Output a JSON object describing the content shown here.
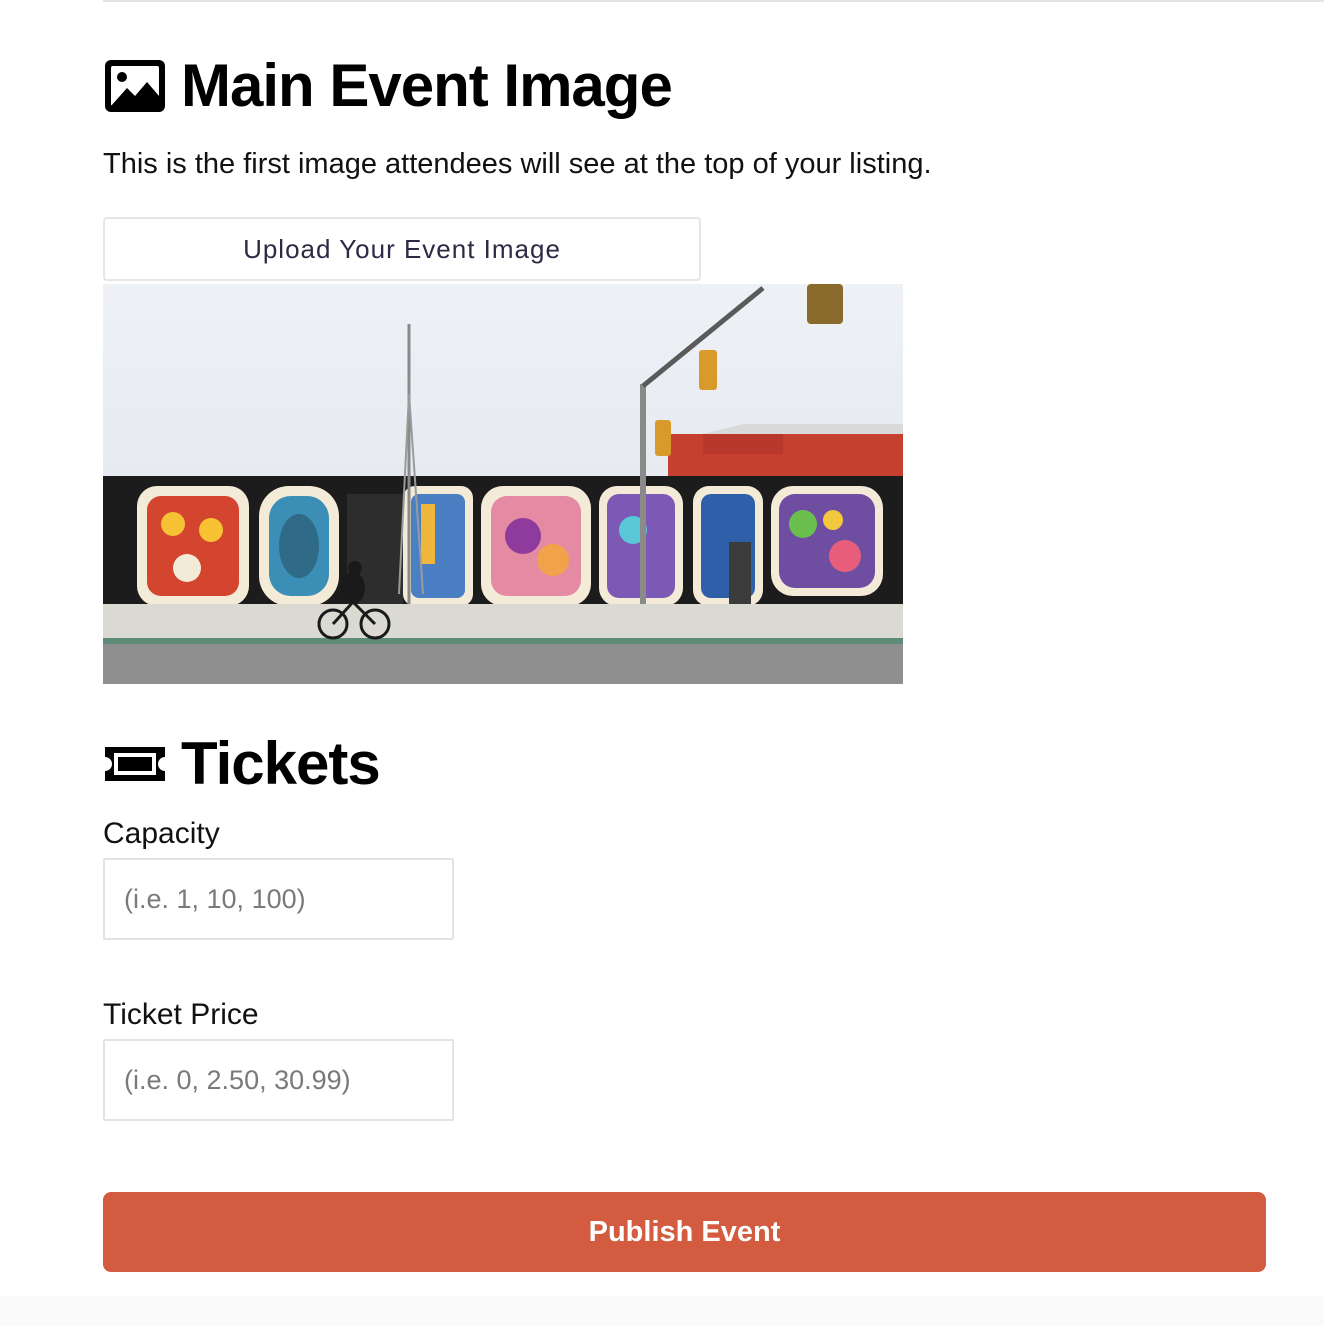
{
  "image_section": {
    "title": "Main Event Image",
    "icon": "image-icon",
    "description": "This is the first image attendees will see at the top of your listing.",
    "upload_label": "Upload Your Event Image",
    "preview_alt": "Street mural"
  },
  "tickets_section": {
    "title": "Tickets",
    "icon": "ticket-icon",
    "capacity": {
      "label": "Capacity",
      "placeholder": "(i.e. 1, 10, 100)",
      "value": ""
    },
    "price": {
      "label": "Ticket Price",
      "placeholder": "(i.e. 0, 2.50, 30.99)",
      "value": ""
    }
  },
  "actions": {
    "publish_label": "Publish Event"
  },
  "colors": {
    "accent": "#d35b3f",
    "text": "#000000",
    "border": "#e3e3e6"
  }
}
